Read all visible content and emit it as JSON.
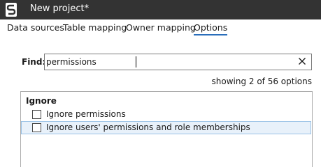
{
  "window": {
    "title": "New project*",
    "app_icon": "letter-s-logo-icon"
  },
  "tabs": [
    {
      "label": "Data sources",
      "active": false
    },
    {
      "label": "Table mapping",
      "active": false
    },
    {
      "label": "Owner mapping",
      "active": false
    },
    {
      "label": "Options",
      "active": true
    }
  ],
  "find": {
    "label": "Find:",
    "value": "permissions",
    "clear_icon": "close-icon"
  },
  "status": {
    "showing": "showing 2 of 56 options"
  },
  "group": {
    "title": "Ignore",
    "options": [
      {
        "label": "Ignore permissions",
        "checked": false,
        "highlighted": false
      },
      {
        "label": "Ignore users' permissions and role memberships",
        "checked": false,
        "highlighted": true
      }
    ]
  },
  "colors": {
    "titlebar": "#333333",
    "accent": "#2a6ebb",
    "highlight_bg": "#e8f1fa",
    "highlight_border": "#99c2e6"
  }
}
